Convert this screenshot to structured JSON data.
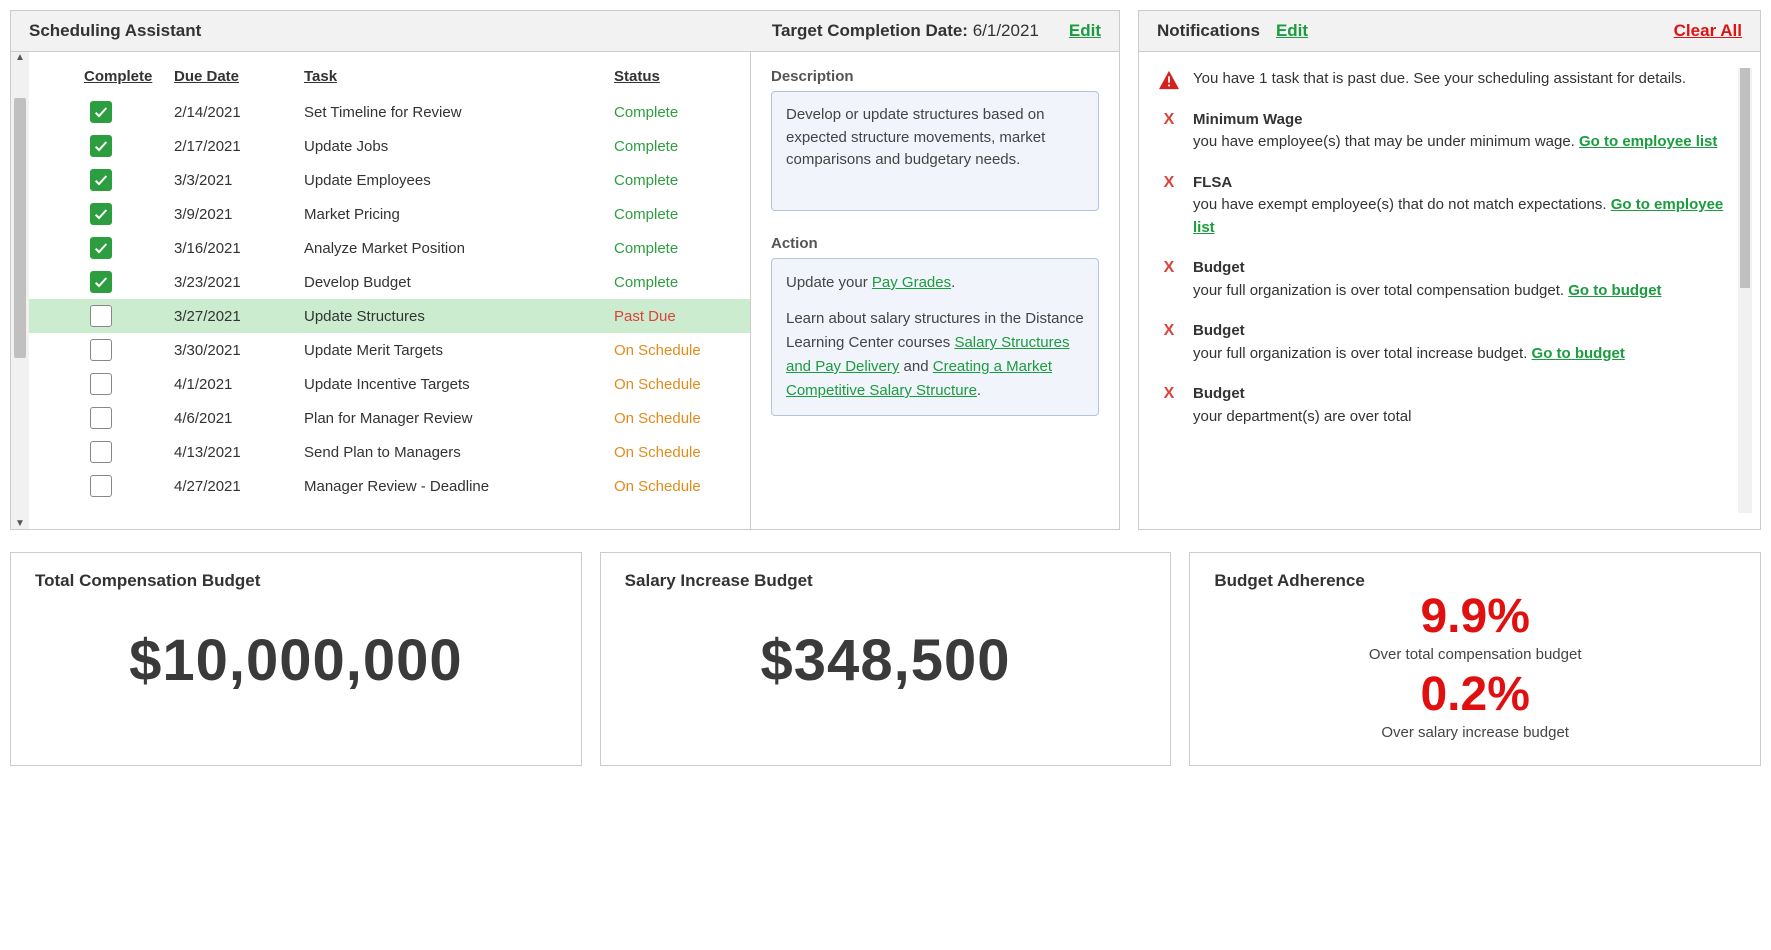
{
  "scheduler": {
    "title": "Scheduling Assistant",
    "target_label": "Target Completion Date:",
    "target_date": "6/1/2021",
    "edit": "Edit",
    "columns": {
      "complete": "Complete",
      "due": "Due Date",
      "task": "Task",
      "status": "Status"
    },
    "tasks": [
      {
        "done": true,
        "due": "2/14/2021",
        "name": "Set Timeline for Review",
        "status": "Complete",
        "kind": "complete"
      },
      {
        "done": true,
        "due": "2/17/2021",
        "name": "Update Jobs",
        "status": "Complete",
        "kind": "complete"
      },
      {
        "done": true,
        "due": "3/3/2021",
        "name": "Update Employees",
        "status": "Complete",
        "kind": "complete"
      },
      {
        "done": true,
        "due": "3/9/2021",
        "name": "Market Pricing",
        "status": "Complete",
        "kind": "complete"
      },
      {
        "done": true,
        "due": "3/16/2021",
        "name": "Analyze Market Position",
        "status": "Complete",
        "kind": "complete"
      },
      {
        "done": true,
        "due": "3/23/2021",
        "name": "Develop Budget",
        "status": "Complete",
        "kind": "complete"
      },
      {
        "done": false,
        "due": "3/27/2021",
        "name": "Update Structures",
        "status": "Past Due",
        "kind": "past",
        "highlight": true
      },
      {
        "done": false,
        "due": "3/30/2021",
        "name": "Update Merit Targets",
        "status": "On Schedule",
        "kind": "on"
      },
      {
        "done": false,
        "due": "4/1/2021",
        "name": "Update Incentive Targets",
        "status": "On Schedule",
        "kind": "on"
      },
      {
        "done": false,
        "due": "4/6/2021",
        "name": "Plan for Manager Review",
        "status": "On Schedule",
        "kind": "on"
      },
      {
        "done": false,
        "due": "4/13/2021",
        "name": "Send Plan to Managers",
        "status": "On Schedule",
        "kind": "on"
      },
      {
        "done": false,
        "due": "4/27/2021",
        "name": "Manager Review - Deadline",
        "status": "On Schedule",
        "kind": "on"
      }
    ],
    "description_label": "Description",
    "description_text": "Develop or update structures based on expected structure movements, market comparisons and budgetary needs.",
    "action_label": "Action",
    "action": {
      "line1_pre": "Update your ",
      "link1": "Pay Grades",
      "line1_post": ".",
      "line2_pre": "Learn about salary structures in the Distance Learning Center courses ",
      "link2": "Salary Structures and Pay Delivery",
      "mid": " and ",
      "link3": "Creating a Market Competitive Salary Structure",
      "line2_post": "."
    }
  },
  "notifications": {
    "title": "Notifications",
    "edit": "Edit",
    "clear": "Clear All",
    "items": [
      {
        "icon": "warn",
        "title": "",
        "body": "You have 1 task that is past due. See your scheduling assistant for details.",
        "link": ""
      },
      {
        "icon": "x",
        "title": "Minimum Wage",
        "body": "you have employee(s) that may be under minimum wage. ",
        "link": "Go to employee list"
      },
      {
        "icon": "x",
        "title": "FLSA",
        "body": "you have exempt employee(s) that do not match expectations.",
        "link": "Go to employee list"
      },
      {
        "icon": "x",
        "title": "Budget",
        "body": "your full organization is over total compensation budget. ",
        "link": "Go to budget"
      },
      {
        "icon": "x",
        "title": "Budget",
        "body": "your full organization is over total increase budget. ",
        "link": "Go to budget"
      },
      {
        "icon": "x",
        "title": "Budget",
        "body": "your department(s) are over total",
        "link": ""
      }
    ]
  },
  "cards": {
    "total_comp_title": "Total Compensation Budget",
    "total_comp_value": "$10,000,000",
    "salary_inc_title": "Salary Increase Budget",
    "salary_inc_value": "$348,500",
    "adherence_title": "Budget Adherence",
    "adh1_pct": "9.9%",
    "adh1_sub": "Over total compensation budget",
    "adh2_pct": "0.2%",
    "adh2_sub": "Over salary increase budget"
  }
}
